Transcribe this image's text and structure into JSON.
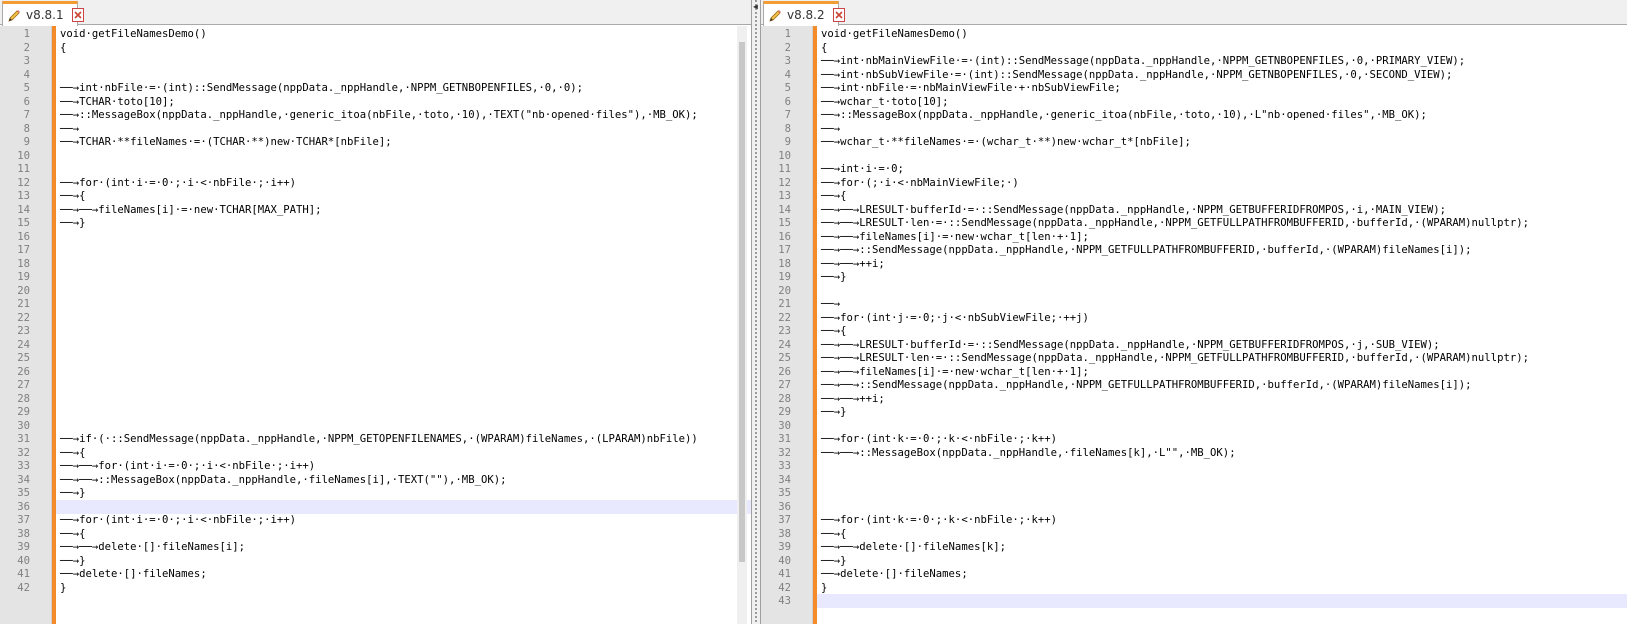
{
  "accent_color": "#f38b2a",
  "left": {
    "tab_label": "v8.8.1",
    "tab_icon": "pencil-edit-icon",
    "close_icon": "close-icon",
    "highlight_line": 36,
    "lines": [
      "void·getFileNamesDemo()",
      "{",
      "",
      "",
      "──→int·nbFile·=·(int)::SendMessage(nppData._nppHandle,·NPPM_GETNBOPENFILES,·0,·0);",
      "──→TCHAR·toto[10];",
      "──→::MessageBox(nppData._nppHandle,·generic_itoa(nbFile,·toto,·10),·TEXT(\"nb·opened·files\"),·MB_OK);",
      "──→",
      "──→TCHAR·**fileNames·=·(TCHAR·**)new·TCHAR*[nbFile];",
      "",
      "",
      "──→for·(int·i·=·0·;·i·<·nbFile·;·i++)",
      "──→{",
      "──→──→fileNames[i]·=·new·TCHAR[MAX_PATH];",
      "──→}",
      "",
      "",
      "",
      "",
      "",
      "",
      "",
      "",
      "",
      "",
      "",
      "",
      "",
      "",
      "",
      "──→if·(·::SendMessage(nppData._nppHandle,·NPPM_GETOPENFILENAMES,·(WPARAM)fileNames,·(LPARAM)nbFile))",
      "──→{",
      "──→──→for·(int·i·=·0·;·i·<·nbFile·;·i++)",
      "──→──→::MessageBox(nppData._nppHandle,·fileNames[i],·TEXT(\"\"),·MB_OK);",
      "──→}",
      "",
      "──→for·(int·i·=·0·;·i·<·nbFile·;·i++)",
      "──→{",
      "──→──→delete·[]·fileNames[i];",
      "──→}",
      "──→delete·[]·fileNames;",
      "}"
    ]
  },
  "right": {
    "tab_label": "v8.8.2",
    "tab_icon": "pencil-edit-icon",
    "close_icon": "close-icon",
    "highlight_line": 43,
    "lines": [
      "void·getFileNamesDemo()",
      "{",
      "──→int·nbMainViewFile·=·(int)::SendMessage(nppData._nppHandle,·NPPM_GETNBOPENFILES,·0,·PRIMARY_VIEW);",
      "──→int·nbSubViewFile·=·(int)::SendMessage(nppData._nppHandle,·NPPM_GETNBOPENFILES,·0,·SECOND_VIEW);",
      "──→int·nbFile·=·nbMainViewFile·+·nbSubViewFile;",
      "──→wchar_t·toto[10];",
      "──→::MessageBox(nppData._nppHandle,·generic_itoa(nbFile,·toto,·10),·L\"nb·opened·files\",·MB_OK);",
      "──→",
      "──→wchar_t·**fileNames·=·(wchar_t·**)new·wchar_t*[nbFile];",
      "",
      "──→int·i·=·0;",
      "──→for·(;·i·<·nbMainViewFile;·)",
      "──→{",
      "──→──→LRESULT·bufferId·=·::SendMessage(nppData._nppHandle,·NPPM_GETBUFFERIDFROMPOS,·i,·MAIN_VIEW);",
      "──→──→LRESULT·len·=·::SendMessage(nppData._nppHandle,·NPPM_GETFULLPATHFROMBUFFERID,·bufferId,·(WPARAM)nullptr);",
      "──→──→fileNames[i]·=·new·wchar_t[len·+·1];",
      "──→──→::SendMessage(nppData._nppHandle,·NPPM_GETFULLPATHFROMBUFFERID,·bufferId,·(WPARAM)fileNames[i]);",
      "──→──→++i;",
      "──→}",
      "",
      "──→",
      "──→for·(int·j·=·0;·j·<·nbSubViewFile;·++j)",
      "──→{",
      "──→──→LRESULT·bufferId·=·::SendMessage(nppData._nppHandle,·NPPM_GETBUFFERIDFROMPOS,·j,·SUB_VIEW);",
      "──→──→LRESULT·len·=·::SendMessage(nppData._nppHandle,·NPPM_GETFULLPATHFROMBUFFERID,·bufferId,·(WPARAM)nullptr);",
      "──→──→fileNames[i]·=·new·wchar_t[len·+·1];",
      "──→──→::SendMessage(nppData._nppHandle,·NPPM_GETFULLPATHFROMBUFFERID,·bufferId,·(WPARAM)fileNames[i]);",
      "──→──→++i;",
      "──→}",
      "",
      "──→for·(int·k·=·0·;·k·<·nbFile·;·k++)",
      "──→──→::MessageBox(nppData._nppHandle,·fileNames[k],·L\"\",·MB_OK);",
      "",
      "",
      "",
      "",
      "──→for·(int·k·=·0·;·k·<·nbFile·;·k++)",
      "──→{",
      "──→──→delete·[]·fileNames[k];",
      "──→}",
      "──→delete·[]·fileNames;",
      "}",
      ""
    ]
  }
}
